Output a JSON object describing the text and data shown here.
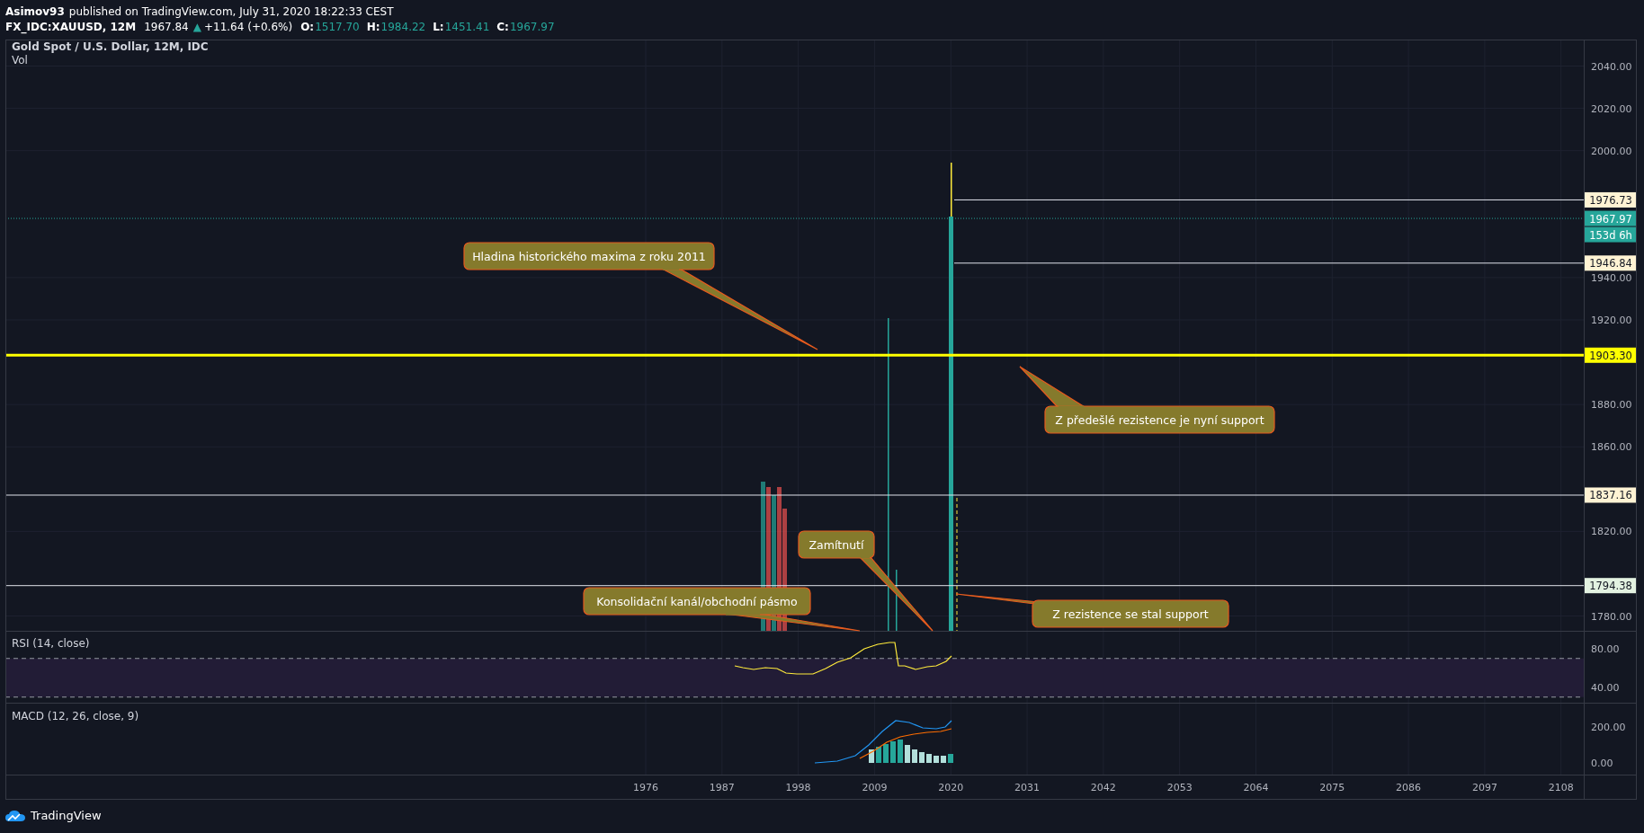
{
  "header": {
    "author": "Asimov93",
    "published": "published on TradingView.com, July 31, 2020 18:22:33 CEST"
  },
  "symbol": {
    "ticker": "FX_IDC:XAUUSD, 12M",
    "last": "1967.84",
    "arrow": "▲",
    "change": "+11.64 (+0.6%)",
    "ohlc": [
      {
        "label": "O:",
        "value": "1517.70"
      },
      {
        "label": "H:",
        "value": "1984.22"
      },
      {
        "label": "L:",
        "value": "1451.41"
      },
      {
        "label": "C:",
        "value": "1967.97"
      }
    ]
  },
  "main_pane": {
    "title": "Gold Spot / U.S. Dollar, 12M, IDC",
    "volume_label": "Vol",
    "price_ticks": [
      "2040.00",
      "2020.00",
      "2000.00",
      "1940.00",
      "1920.00",
      "1880.00",
      "1860.00",
      "1820.00",
      "1780.00"
    ],
    "price_labels": [
      {
        "text": "1976.73",
        "kind": "ray",
        "color": "#fff3d4"
      },
      {
        "text": "1967.97",
        "kind": "last",
        "color": "#26a69a"
      },
      {
        "text": "153d 6h",
        "kind": "countdown",
        "color": "#26a69a"
      },
      {
        "text": "1946.84",
        "kind": "ray",
        "color": "#fff3d4"
      },
      {
        "text": "1903.30",
        "kind": "level",
        "color": "#ffff00"
      },
      {
        "text": "1837.16",
        "kind": "line",
        "color": "#fff3d4"
      },
      {
        "text": "1794.38",
        "kind": "line",
        "color": "#e3f2e1"
      }
    ],
    "callouts": [
      {
        "text": "Hladina historického maxima z roku 2011"
      },
      {
        "text": "Z předešlé rezistence je nyní support"
      },
      {
        "text": "Zamítnutí"
      },
      {
        "text": "Konsolidační kanál/obchodní pásmo"
      },
      {
        "text": "Z rezistence se stal support"
      }
    ]
  },
  "rsi_pane": {
    "title": "RSI (14, close)",
    "ticks": [
      "80.00",
      "40.00"
    ]
  },
  "macd_pane": {
    "title": "MACD (12, 26, close, 9)",
    "ticks": [
      "200.00",
      "0.00"
    ]
  },
  "time_axis": [
    "1976",
    "1987",
    "1998",
    "2009",
    "2020",
    "2031",
    "2042",
    "2053",
    "2064",
    "2075",
    "2086",
    "2097",
    "2108"
  ],
  "footer": {
    "brand": "TradingView"
  }
}
